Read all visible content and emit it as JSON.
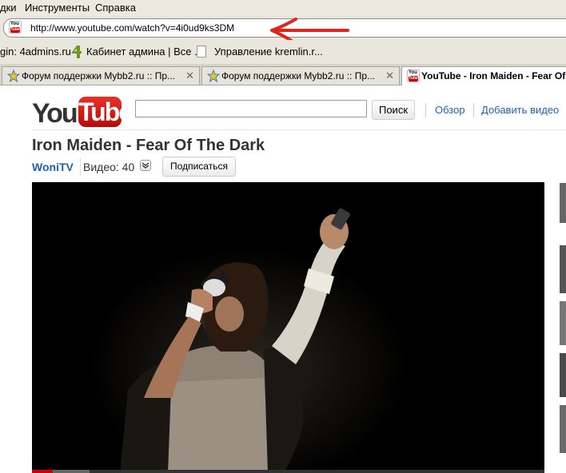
{
  "menubar": {
    "items": [
      "дки",
      "Инструменты",
      "Справка"
    ]
  },
  "navbar": {
    "url": "http://www.youtube.com/watch?v=4i0ud9ks3DM",
    "favicon_icon": "youtube-favicon-icon",
    "favicon_text_top": "You",
    "favicon_text_bottom": "Tube"
  },
  "bookmarks": {
    "items": [
      "gin: 4admins.ru",
      "Кабинет админа | Все ...",
      "Управление kremlin.r..."
    ]
  },
  "tabs": [
    {
      "label": "Форум поддержки Mybb2.ru :: Пр..."
    },
    {
      "label": "Форум поддержки Mybb2.ru :: Пр..."
    },
    {
      "label": "YouTube - Iron Maiden - Fear Of The Dark"
    }
  ],
  "youtube": {
    "logo_you": "You",
    "logo_tube": "Tube",
    "search_button": "Поиск",
    "links": [
      "Обзор",
      "Добавить видео"
    ],
    "video_title": "Iron Maiden - Fear Of The Dark",
    "channel": "WoniTV",
    "videos_label": "Видео: 40",
    "subscribe": "Подписаться"
  },
  "colors": {
    "link": "#1c62b9",
    "annotation_arrow": "#e0251b",
    "brand_red": "#cc0000"
  }
}
